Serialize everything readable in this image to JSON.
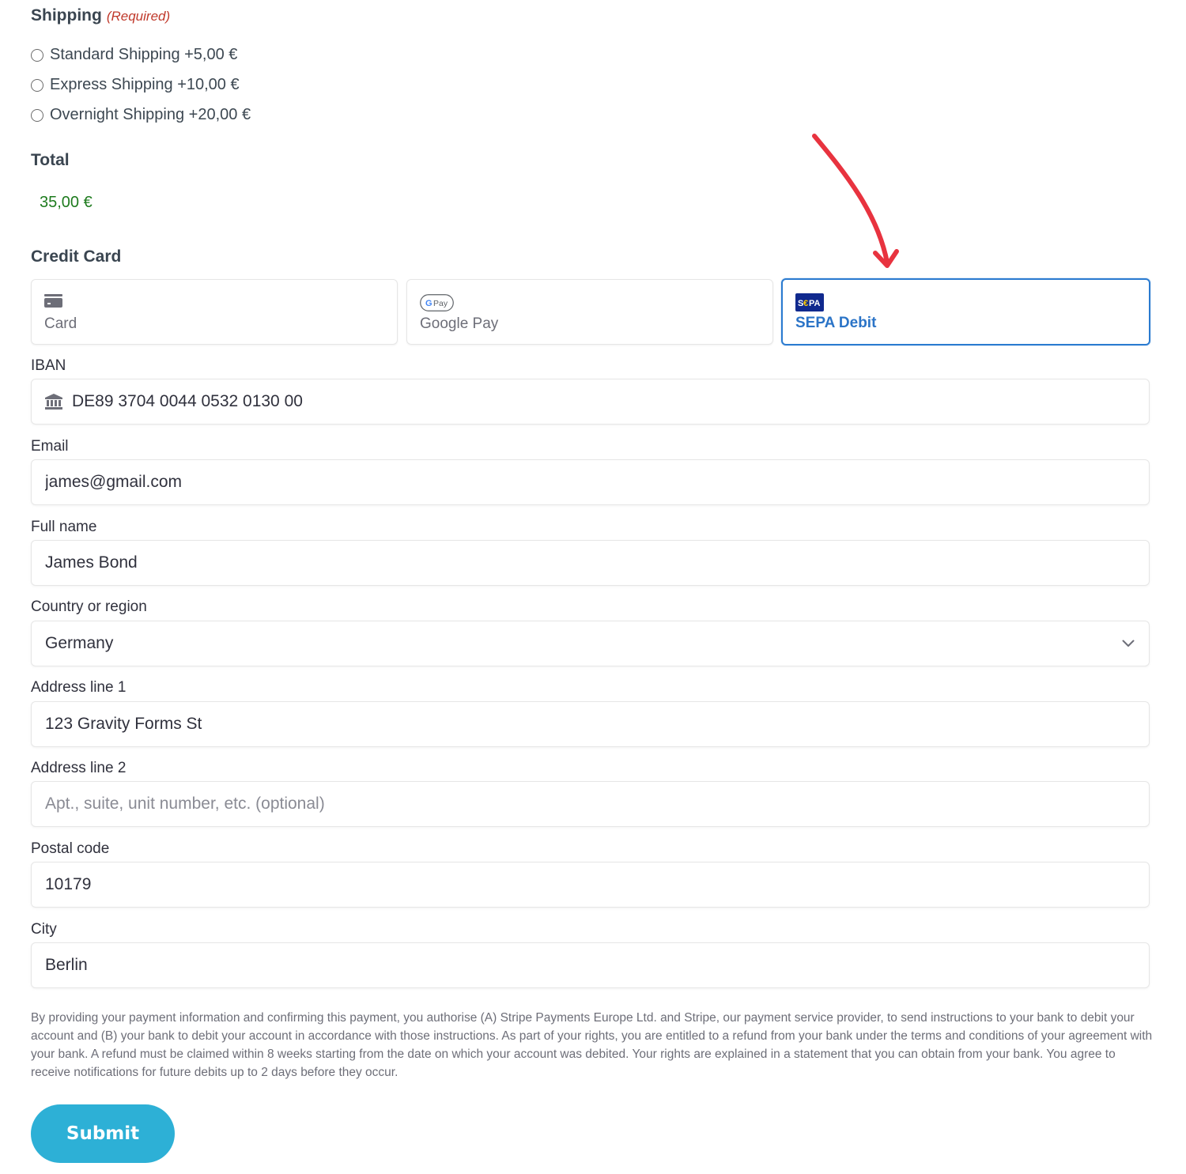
{
  "shipping": {
    "title": "Shipping",
    "required_label": "(Required)",
    "options": [
      {
        "label": "Standard Shipping +5,00 €",
        "selected": false
      },
      {
        "label": "Express Shipping +10,00 €",
        "selected": false
      },
      {
        "label": "Overnight Shipping +20,00 €",
        "selected": false
      }
    ]
  },
  "total": {
    "title": "Total",
    "value": "35,00 €",
    "color": "#1e7b1e"
  },
  "payment": {
    "title": "Credit Card",
    "methods": [
      {
        "label": "Card",
        "icon": "credit-card-icon",
        "active": false
      },
      {
        "label": "Google Pay",
        "icon": "google-pay-icon",
        "icon_text": "Pay",
        "active": false
      },
      {
        "label": "SEPA Debit",
        "icon": "sepa-icon",
        "icon_text": "S€PA",
        "active": true
      }
    ],
    "accent_color": "#2b74c7"
  },
  "form": {
    "iban": {
      "label": "IBAN",
      "value": "DE89 3704 0044 0532 0130 00",
      "icon": "bank-icon"
    },
    "email": {
      "label": "Email",
      "value": "james@gmail.com"
    },
    "full_name": {
      "label": "Full name",
      "value": "James Bond"
    },
    "country": {
      "label": "Country or region",
      "value": "Germany"
    },
    "address1": {
      "label": "Address line 1",
      "value": "123 Gravity Forms St"
    },
    "address2": {
      "label": "Address line 2",
      "value": "",
      "placeholder": "Apt., suite, unit number, etc. (optional)"
    },
    "postal": {
      "label": "Postal code",
      "value": "10179"
    },
    "city": {
      "label": "City",
      "value": "Berlin"
    }
  },
  "mandate_text": "By providing your payment information and confirming this payment, you authorise (A) Stripe Payments Europe Ltd. and Stripe, our payment service provider, to send instructions to your bank to debit your account and (B) your bank to debit your account in accordance with those instructions. As part of your rights, you are entitled to a refund from your bank under the terms and conditions of your agreement with your bank. A refund must be claimed within 8 weeks starting from the date on which your account was debited. Your rights are explained in a statement that you can obtain from your bank. You agree to receive notifications for future debits up to 2 days before they occur.",
  "submit": {
    "label": "Submit",
    "color": "#2db0d6"
  },
  "annotation": {
    "type": "red-arrow",
    "color": "#e8333f",
    "points_to": "SEPA Debit"
  }
}
